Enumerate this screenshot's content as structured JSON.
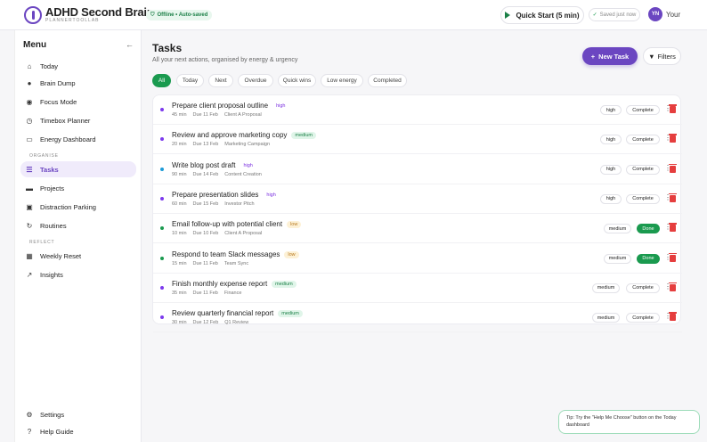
{
  "header": {
    "app_title": "ADHD Second Brain",
    "app_subtitle": "PLANNERTOOLLAB",
    "status": "Offline • Auto-saved",
    "quick_start": "Quick Start (5 min)",
    "saved": "Saved just now",
    "avatar_initials": "YN",
    "user_label": "Your"
  },
  "sidebar": {
    "title": "Menu",
    "items": [
      {
        "label": "Today",
        "icon": "home-icon"
      },
      {
        "label": "Brain Dump",
        "icon": "lightbulb-icon"
      },
      {
        "label": "Focus Mode",
        "icon": "target-icon"
      },
      {
        "label": "Timebox Planner",
        "icon": "clock-icon"
      },
      {
        "label": "Energy Dashboard",
        "icon": "battery-icon"
      }
    ],
    "organise_label": "ORGANISE",
    "organise_items": [
      {
        "label": "Tasks",
        "icon": "list-icon"
      },
      {
        "label": "Projects",
        "icon": "folder-icon"
      },
      {
        "label": "Distraction Parking",
        "icon": "parking-icon"
      },
      {
        "label": "Routines",
        "icon": "refresh-icon"
      }
    ],
    "reflect_label": "REFLECT",
    "reflect_items": [
      {
        "label": "Weekly Reset",
        "icon": "calendar-icon"
      },
      {
        "label": "Insights",
        "icon": "chart-icon"
      }
    ],
    "bottom_items": [
      {
        "label": "Settings",
        "icon": "gear-icon"
      },
      {
        "label": "Help Guide",
        "icon": "help-icon"
      }
    ]
  },
  "main": {
    "title": "Tasks",
    "subtitle": "All your next actions, organised by energy & urgency",
    "new_task": "New Task",
    "filters": "Filters",
    "tabs": [
      "All",
      "Today",
      "Next",
      "Overdue",
      "Quick wins",
      "Low energy",
      "Completed"
    ],
    "tasks": [
      {
        "title": "Prepare client proposal outline",
        "tag": "high",
        "duration": "45 min",
        "due": "Due 11 Feb",
        "project": "Client A Proposal",
        "energy": "high",
        "action": "Complete",
        "dot": "#7c3aed"
      },
      {
        "title": "Review and approve marketing copy",
        "tag": "medium",
        "duration": "20 min",
        "due": "Due 13 Feb",
        "project": "Marketing Campaign",
        "energy": "high",
        "action": "Complete",
        "dot": "#7c3aed"
      },
      {
        "title": "Write blog post draft",
        "tag": "high",
        "duration": "90 min",
        "due": "Due 14 Feb",
        "project": "Content Creation",
        "energy": "high",
        "action": "Complete",
        "dot": "#1e9bd7"
      },
      {
        "title": "Prepare presentation slides",
        "tag": "high",
        "duration": "60 min",
        "due": "Due 15 Feb",
        "project": "Investor Pitch",
        "energy": "high",
        "action": "Complete",
        "dot": "#7c3aed"
      },
      {
        "title": "Email follow-up with potential client",
        "tag": "low",
        "duration": "10 min",
        "due": "Due 10 Feb",
        "project": "Client A Proposal",
        "energy": "medium",
        "action": "Done",
        "dot": "#1a9a4f"
      },
      {
        "title": "Respond to team Slack messages",
        "tag": "low",
        "duration": "15 min",
        "due": "Due 11 Feb",
        "project": "Team Sync",
        "energy": "medium",
        "action": "Done",
        "dot": "#1a9a4f"
      },
      {
        "title": "Finish monthly expense report",
        "tag": "medium",
        "duration": "35 min",
        "due": "Due 11 Feb",
        "project": "Finance",
        "energy": "medium",
        "action": "Complete",
        "dot": "#7c3aed"
      },
      {
        "title": "Review quarterly financial report",
        "tag": "medium",
        "duration": "30 min",
        "due": "Due 12 Feb",
        "project": "Q1 Review",
        "energy": "medium",
        "action": "Complete",
        "dot": "#7c3aed"
      }
    ]
  },
  "tip": "Tip: Try the \"Help Me Choose\" button on the Today dashboard",
  "colors": {
    "accent": "#6b46c1",
    "green": "#1a9a4f",
    "danger": "#e53e3e"
  }
}
